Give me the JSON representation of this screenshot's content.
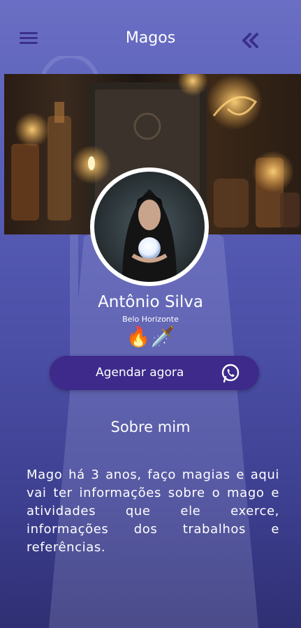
{
  "header": {
    "title": "Magos",
    "menu_icon": "hamburger-menu-icon",
    "back_icon": "double-chevron-left-icon"
  },
  "profile": {
    "name": "Antônio Silva",
    "city": "Belo Horizonte",
    "badges": "🔥🗡️"
  },
  "cta": {
    "label": "Agendar agora",
    "icon": "whatsapp-icon"
  },
  "about": {
    "title": "Sobre mim",
    "text": "Mago há 3 anos, faço magias e aqui vai ter informações sobre o mago e atividades que ele exerce, informações dos trabalhos e referências."
  },
  "colors": {
    "accent": "#3d2a8a",
    "background_top": "#6a6fc4",
    "background_bottom": "#2f2f73"
  }
}
